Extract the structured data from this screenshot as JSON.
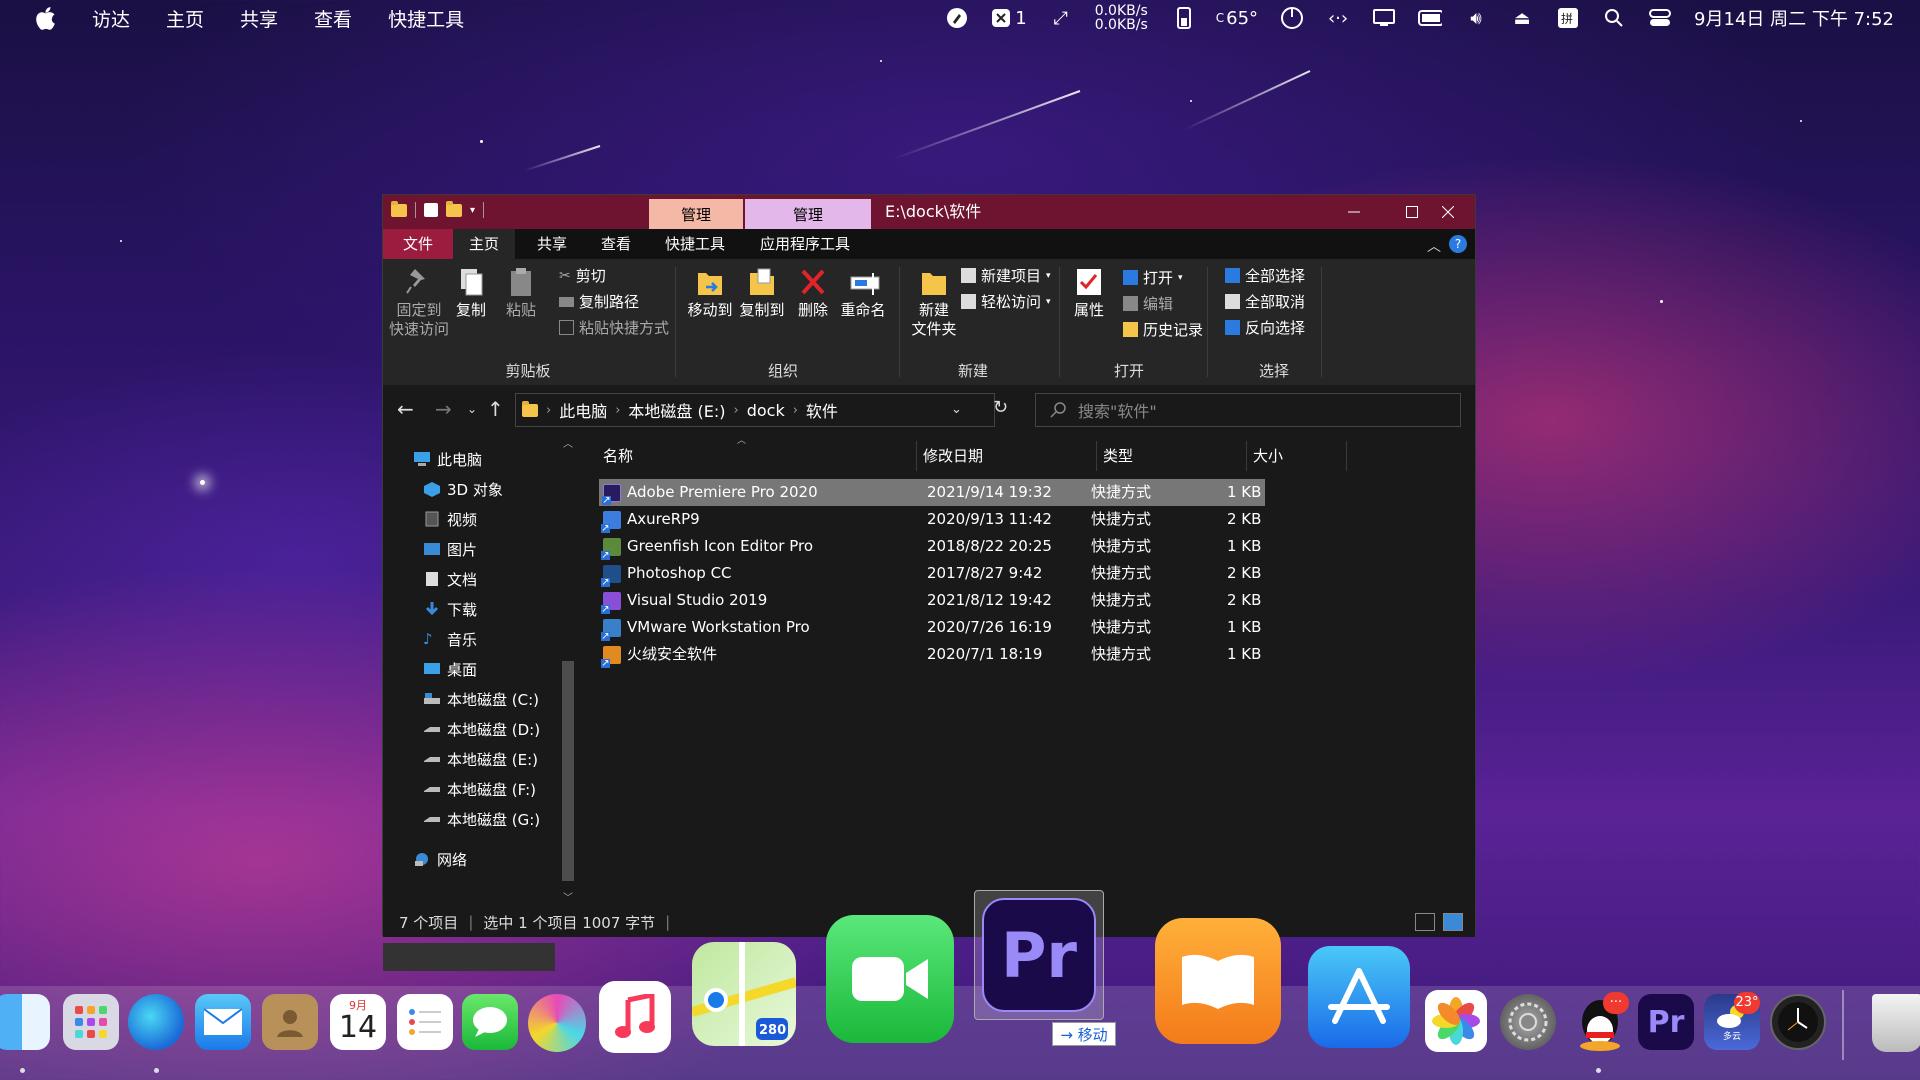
{
  "menubar": {
    "menu_items": [
      "访达",
      "主页",
      "共享",
      "查看",
      "快捷工具"
    ],
    "badge_count": "1",
    "net_up": "0.0KB/s",
    "net_down": "0.0KB/s",
    "temp": "65°",
    "datetime": "9月14日 周二 下午 7:52"
  },
  "window": {
    "title": "E:\\dock\\软件",
    "context_tabs": [
      "管理",
      "管理"
    ],
    "tabs": [
      "文件",
      "主页",
      "共享",
      "查看",
      "快捷工具",
      "应用程序工具"
    ],
    "ribbon": {
      "pin": [
        "固定到",
        "快速访问"
      ],
      "copy": "复制",
      "paste": "粘贴",
      "cut": "剪切",
      "copy_path": "复制路径",
      "paste_shortcut": "粘贴快捷方式",
      "move_to": "移动到",
      "copy_to": "复制到",
      "delete": "删除",
      "rename": "重命名",
      "new_folder": [
        "新建",
        "文件夹"
      ],
      "new_item": "新建项目",
      "easy_access": "轻松访问",
      "properties": "属性",
      "open": "打开",
      "edit": "编辑",
      "history": "历史记录",
      "select_all": "全部选择",
      "select_none": "全部取消",
      "invert_select": "反向选择",
      "groups": [
        "剪贴板",
        "组织",
        "新建",
        "打开",
        "选择"
      ]
    },
    "address": {
      "crumbs": [
        "此电脑",
        "本地磁盘 (E:)",
        "dock",
        "软件"
      ],
      "search_placeholder": "搜索\"软件\""
    },
    "nav": [
      "此电脑",
      "3D 对象",
      "视频",
      "图片",
      "文档",
      "下载",
      "音乐",
      "桌面",
      "本地磁盘 (C:)",
      "本地磁盘 (D:)",
      "本地磁盘 (E:)",
      "本地磁盘 (F:)",
      "本地磁盘 (G:)",
      "网络"
    ],
    "columns": [
      "名称",
      "修改日期",
      "类型",
      "大小"
    ],
    "files": [
      {
        "name": "Adobe Premiere Pro 2020",
        "date": "2021/9/14 19:32",
        "type": "快捷方式",
        "size": "1 KB",
        "color": "#2a1a5e"
      },
      {
        "name": "AxureRP9",
        "date": "2020/9/13 11:42",
        "type": "快捷方式",
        "size": "2 KB",
        "color": "#3d7de0"
      },
      {
        "name": "Greenfish Icon Editor Pro",
        "date": "2018/8/22 20:25",
        "type": "快捷方式",
        "size": "1 KB",
        "color": "#5a8a3a"
      },
      {
        "name": "Photoshop CC",
        "date": "2017/8/27 9:42",
        "type": "快捷方式",
        "size": "2 KB",
        "color": "#1f4f8a"
      },
      {
        "name": "Visual Studio 2019",
        "date": "2021/8/12 19:42",
        "type": "快捷方式",
        "size": "2 KB",
        "color": "#8a4fd8"
      },
      {
        "name": "VMware Workstation Pro",
        "date": "2020/7/26 16:19",
        "type": "快捷方式",
        "size": "1 KB",
        "color": "#3a80c8"
      },
      {
        "name": "火绒安全软件",
        "date": "2020/7/1 18:19",
        "type": "快捷方式",
        "size": "1 KB",
        "color": "#e08a20"
      }
    ],
    "status": {
      "count": "7 个项目",
      "selected": "选中 1 个项目  1007 字节"
    }
  },
  "dock": {
    "calendar_month": "9月",
    "calendar_day": "14",
    "maps_shield": "280",
    "premiere_label": "Pr",
    "drag_tip": "→ 移动",
    "qq_badge": "···",
    "weather_badge": "23°",
    "weather_label": "多云"
  }
}
